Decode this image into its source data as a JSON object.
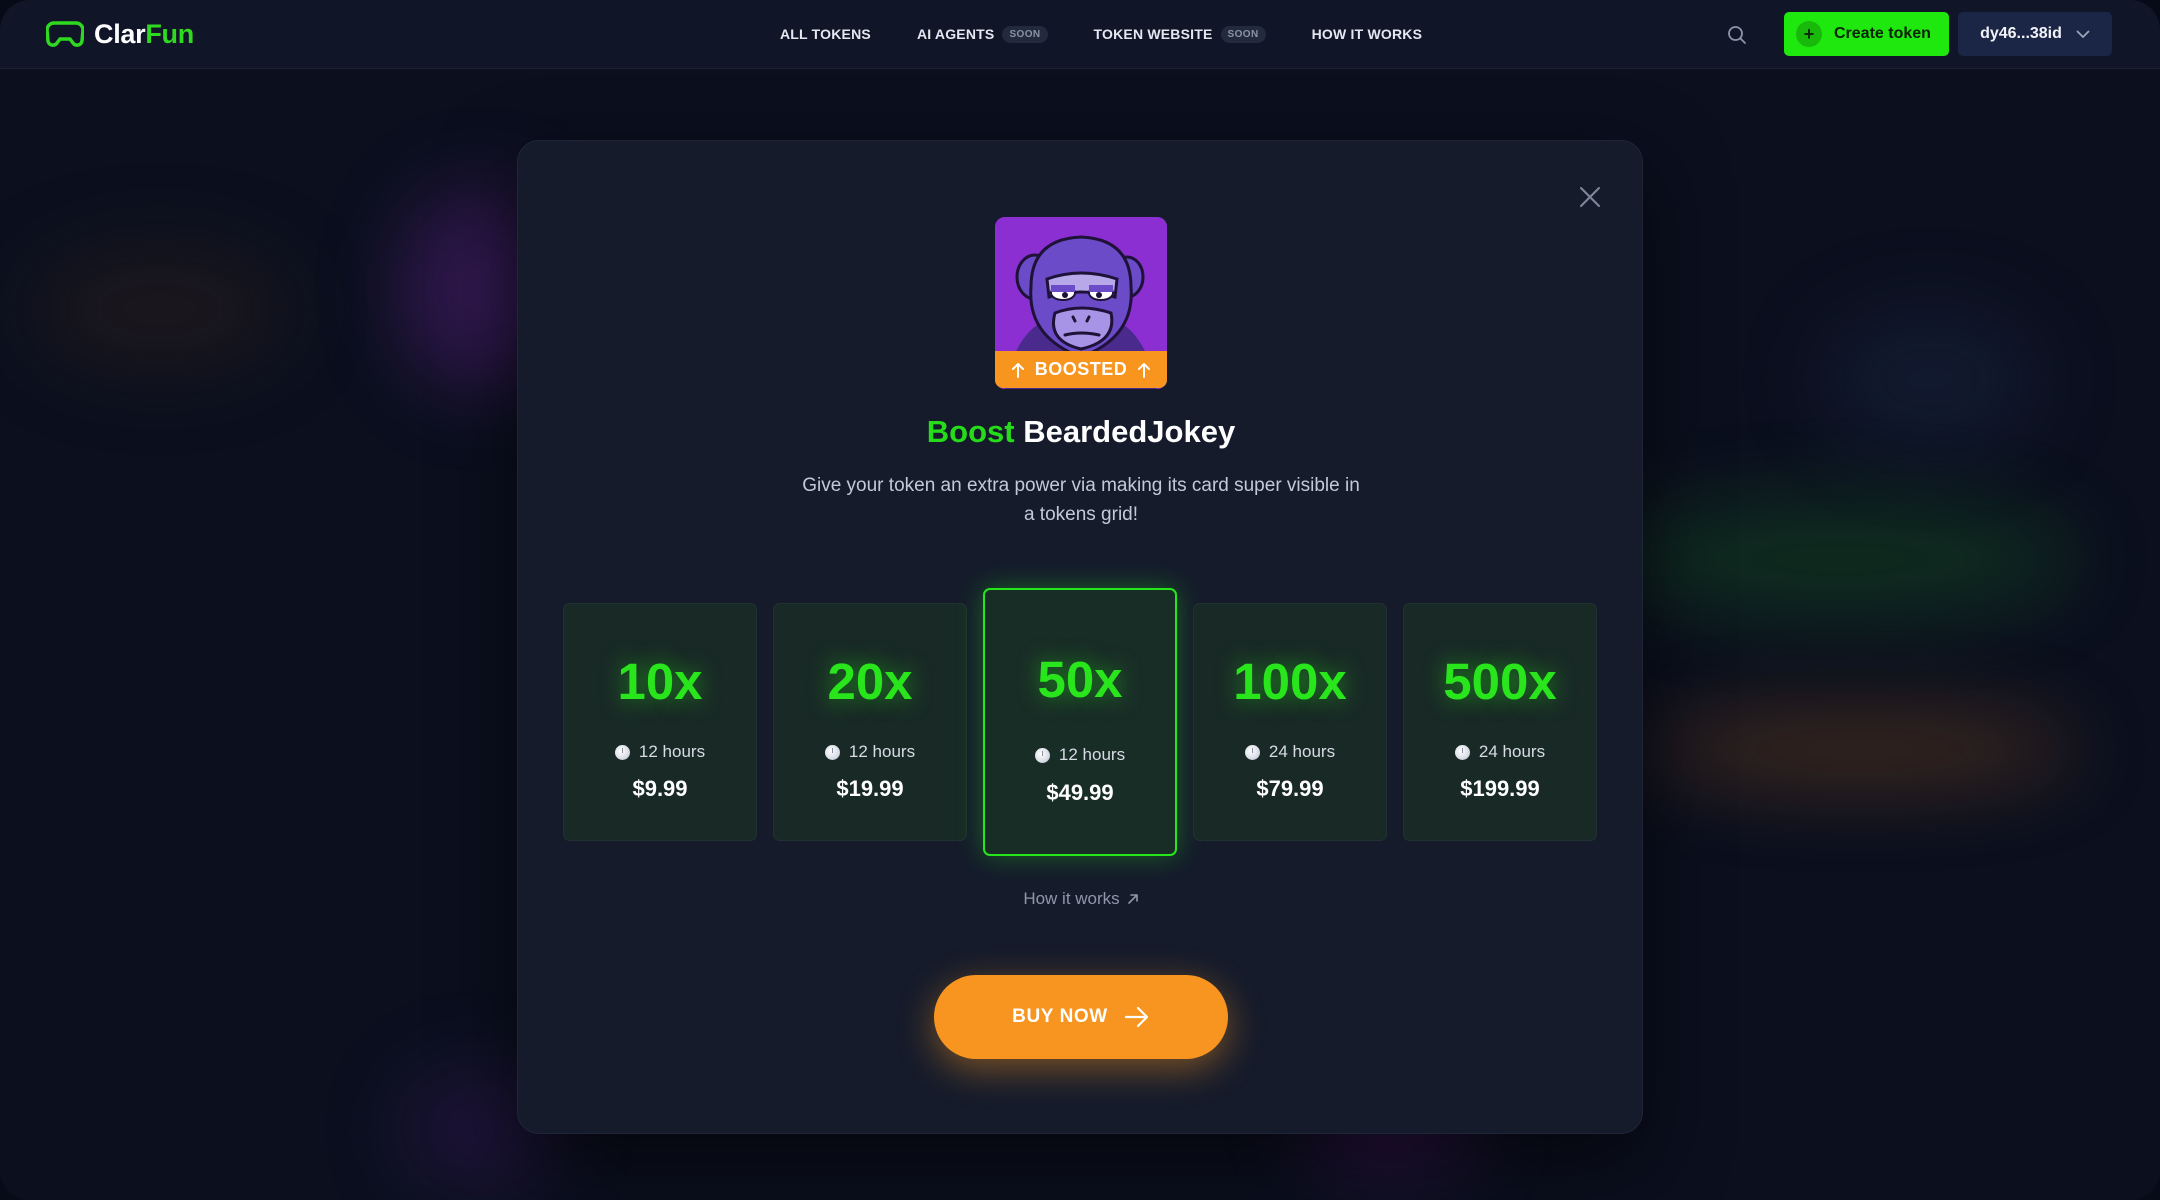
{
  "header": {
    "logo_text_1": "Clar",
    "logo_text_2": "Fun",
    "nav": [
      {
        "label": "ALL TOKENS",
        "badge": ""
      },
      {
        "label": "AI AGENTS",
        "badge": "SOON"
      },
      {
        "label": "TOKEN WEBSITE",
        "badge": "SOON"
      },
      {
        "label": "HOW IT WORKS",
        "badge": ""
      }
    ],
    "create_label": "Create token",
    "create_icon": "plus-icon",
    "wallet_label": "dy46...38id",
    "wallet_icon": "chevron-down-icon",
    "search_icon": "search-icon"
  },
  "modal": {
    "close_icon": "close-icon",
    "token_image": "ape-avatar",
    "badge_label": "BOOSTED",
    "title_accent": "Boost",
    "title_name": "BeardedJokey",
    "description": "Give your token an extra power via making its card super visible in a tokens grid!",
    "plans": [
      {
        "multiplier": "10x",
        "duration": "12 hours",
        "price": "$9.99",
        "selected": false
      },
      {
        "multiplier": "20x",
        "duration": "12 hours",
        "price": "$19.99",
        "selected": false
      },
      {
        "multiplier": "50x",
        "duration": "12 hours",
        "price": "$49.99",
        "selected": true
      },
      {
        "multiplier": "100x",
        "duration": "24 hours",
        "price": "$79.99",
        "selected": false
      },
      {
        "multiplier": "500x",
        "duration": "24 hours",
        "price": "$199.99",
        "selected": false
      }
    ],
    "how_link": "How it works",
    "buy_label": "BUY NOW"
  },
  "colors": {
    "accent_green": "#26dc1a",
    "accent_orange": "#f7951e",
    "background": "#0b0f1e",
    "modal": "#151b2b"
  }
}
